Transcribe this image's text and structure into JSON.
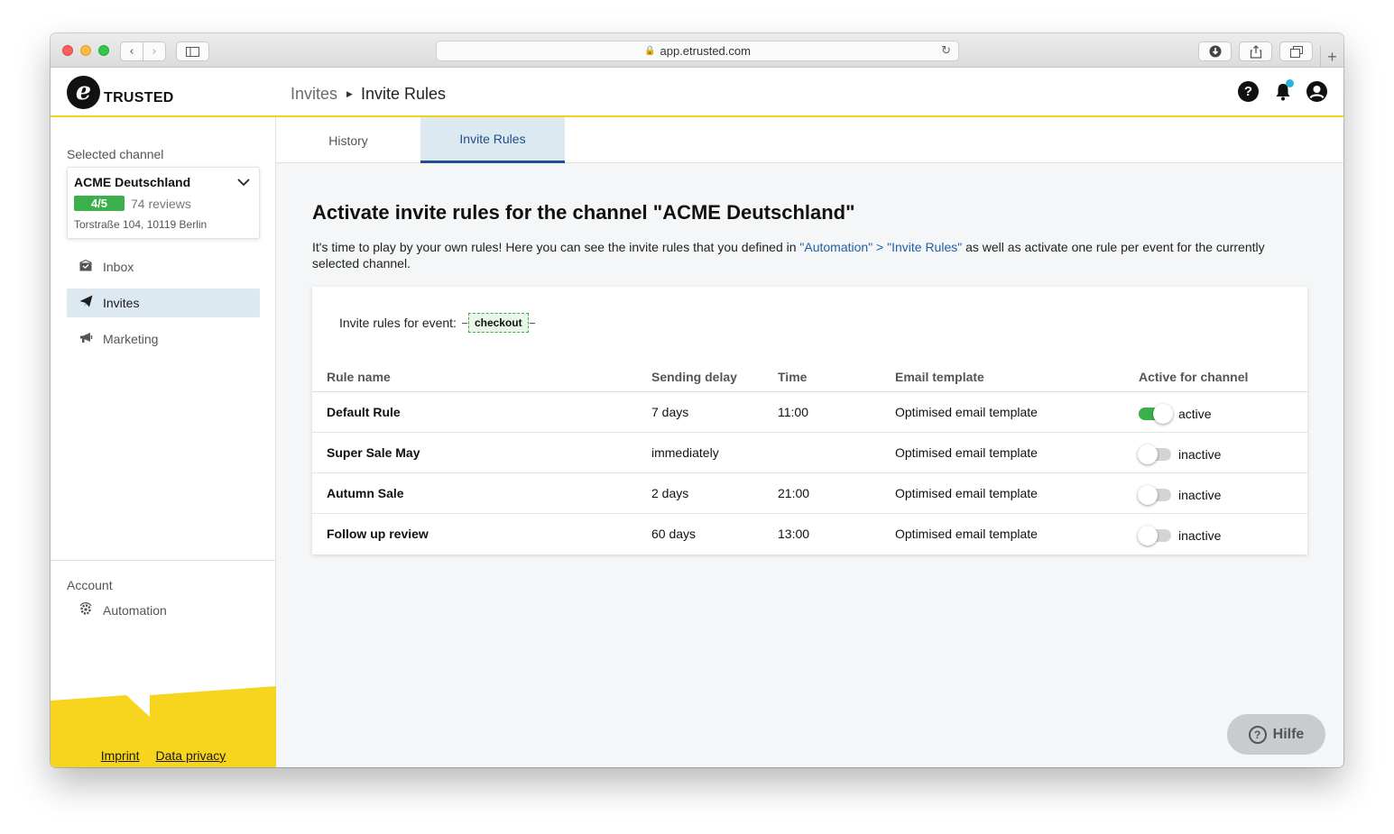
{
  "browser": {
    "url": "app.etrusted.com",
    "back_icon": "chevron-left-icon",
    "forward_icon": "chevron-right-icon"
  },
  "header": {
    "logo_letter": "e",
    "logo_text": "TRUSTED",
    "breadcrumb": {
      "parent": "Invites",
      "current": "Invite Rules"
    },
    "icons": [
      "help-icon",
      "bell-icon",
      "account-icon"
    ],
    "notification_color": "#29b6d6",
    "accent_color": "#f3d21a"
  },
  "sidebar": {
    "selected_channel_label": "Selected channel",
    "channel": {
      "name": "ACME Deutschland",
      "rating": "4/5",
      "reviews": "74 reviews",
      "address": "Torstraße 104, 10119 Berlin"
    },
    "nav": [
      {
        "label": "Inbox",
        "icon": "inbox-icon",
        "active": false
      },
      {
        "label": "Invites",
        "icon": "paper-plane-icon",
        "active": true
      },
      {
        "label": "Marketing",
        "icon": "megaphone-icon",
        "active": false
      }
    ],
    "account_label": "Account",
    "account_nav": [
      {
        "label": "Automation",
        "icon": "automation-gear-icon"
      }
    ],
    "footer": {
      "imprint": "Imprint",
      "privacy": "Data privacy"
    }
  },
  "tabs": [
    {
      "label": "History",
      "active": false
    },
    {
      "label": "Invite Rules",
      "active": true
    }
  ],
  "main": {
    "title": "Activate invite rules for the channel \"ACME Deutschland\"",
    "intro_before": "It's time to play by your own rules! Here you can see the invite rules that you defined in ",
    "intro_link": "\"Automation\" > \"Invite Rules\"",
    "intro_after": " as well as activate one rule per event for the currently selected channel.",
    "event_label": "Invite rules for event:",
    "event_name": "checkout",
    "columns": [
      "Rule name",
      "Sending delay",
      "Time",
      "Email template",
      "Active for channel"
    ],
    "rules": [
      {
        "name": "Default Rule",
        "delay": "7 days",
        "time": "11:00",
        "template": "Optimised email template",
        "status": "active",
        "on": true
      },
      {
        "name": "Super Sale May",
        "delay": "immediately",
        "time": "",
        "template": "Optimised email template",
        "status": "inactive",
        "on": false
      },
      {
        "name": "Autumn Sale",
        "delay": "2 days",
        "time": "21:00",
        "template": "Optimised email template",
        "status": "inactive",
        "on": false
      },
      {
        "name": "Follow up review",
        "delay": "60 days",
        "time": "13:00",
        "template": "Optimised email template",
        "status": "inactive",
        "on": false
      }
    ],
    "help_button": "Hilfe"
  }
}
